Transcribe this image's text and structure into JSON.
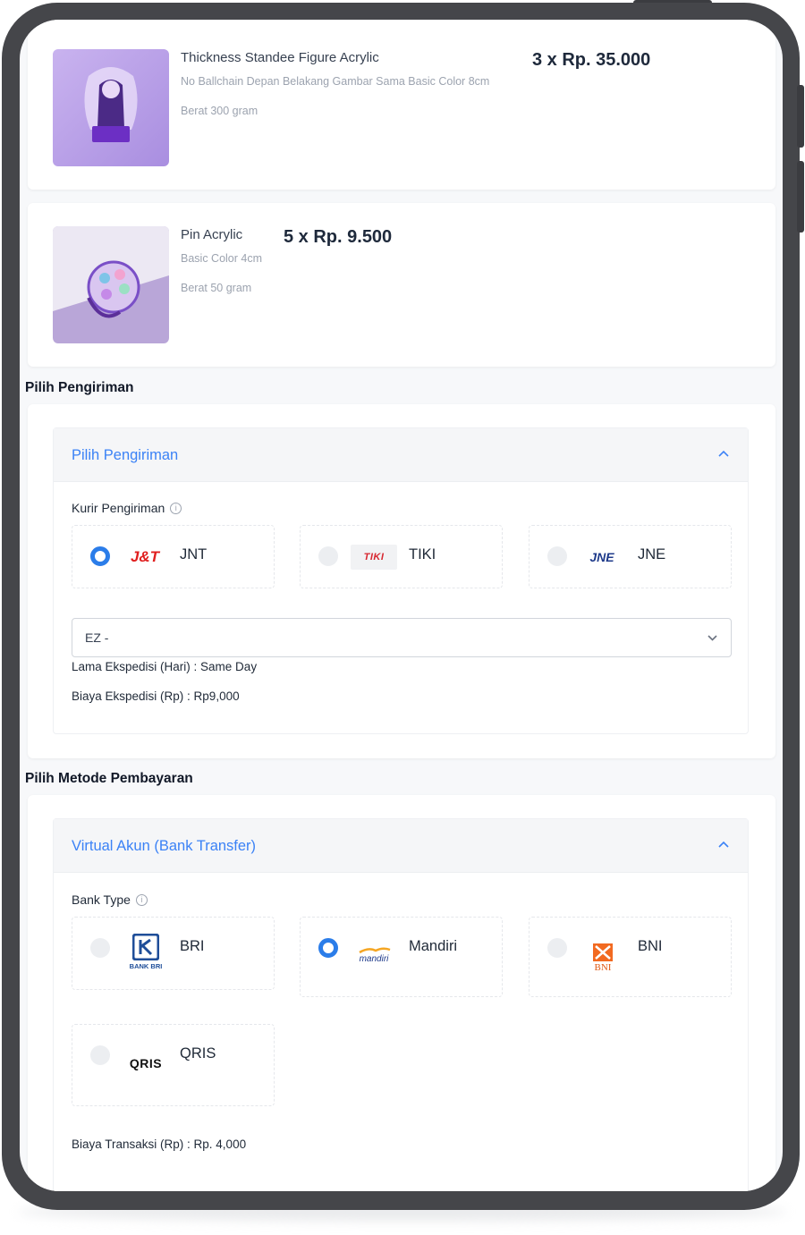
{
  "products": [
    {
      "name": "Thickness Standee Figure Acrylic",
      "description": "No Ballchain Depan Belakang Gambar Sama Basic Color 8cm",
      "weight": "Berat 300 gram",
      "price": "3 x Rp. 35.000"
    },
    {
      "name": "Pin Acrylic",
      "description": "Basic Color 4cm",
      "weight": "Berat 50 gram",
      "price": "5 x Rp. 9.500"
    }
  ],
  "shipping": {
    "section_title": "Pilih Pengiriman",
    "panel_title": "Pilih Pengiriman",
    "courier_label": "Kurir Pengiriman",
    "couriers": [
      {
        "name": "JNT",
        "logo_text": "J&T",
        "selected": true
      },
      {
        "name": "TIKI",
        "logo_text": "TIKI",
        "selected": false
      },
      {
        "name": "JNE",
        "logo_text": "JNE",
        "selected": false
      }
    ],
    "service_value": "EZ -",
    "duration": "Lama Ekspedisi (Hari) : Same Day",
    "cost": "Biaya Ekspedisi (Rp) : Rp9,000"
  },
  "payment": {
    "section_title": "Pilih Metode Pembayaran",
    "panel_title": "Virtual Akun (Bank Transfer)",
    "bank_label": "Bank Type",
    "banks": [
      {
        "name": "BRI",
        "logo_text": "BANK BRI",
        "selected": false
      },
      {
        "name": "Mandiri",
        "logo_text": "mandiri",
        "selected": true
      },
      {
        "name": "BNI",
        "logo_text": "BNI",
        "selected": false
      },
      {
        "name": "QRIS",
        "logo_text": "QRIS",
        "selected": false
      }
    ],
    "fee": "Biaya Transaksi (Rp) : Rp. 4,000"
  },
  "colors": {
    "accent": "#3b82f6",
    "radio_selected": "#2b7de9",
    "device_frame": "#45464a"
  }
}
